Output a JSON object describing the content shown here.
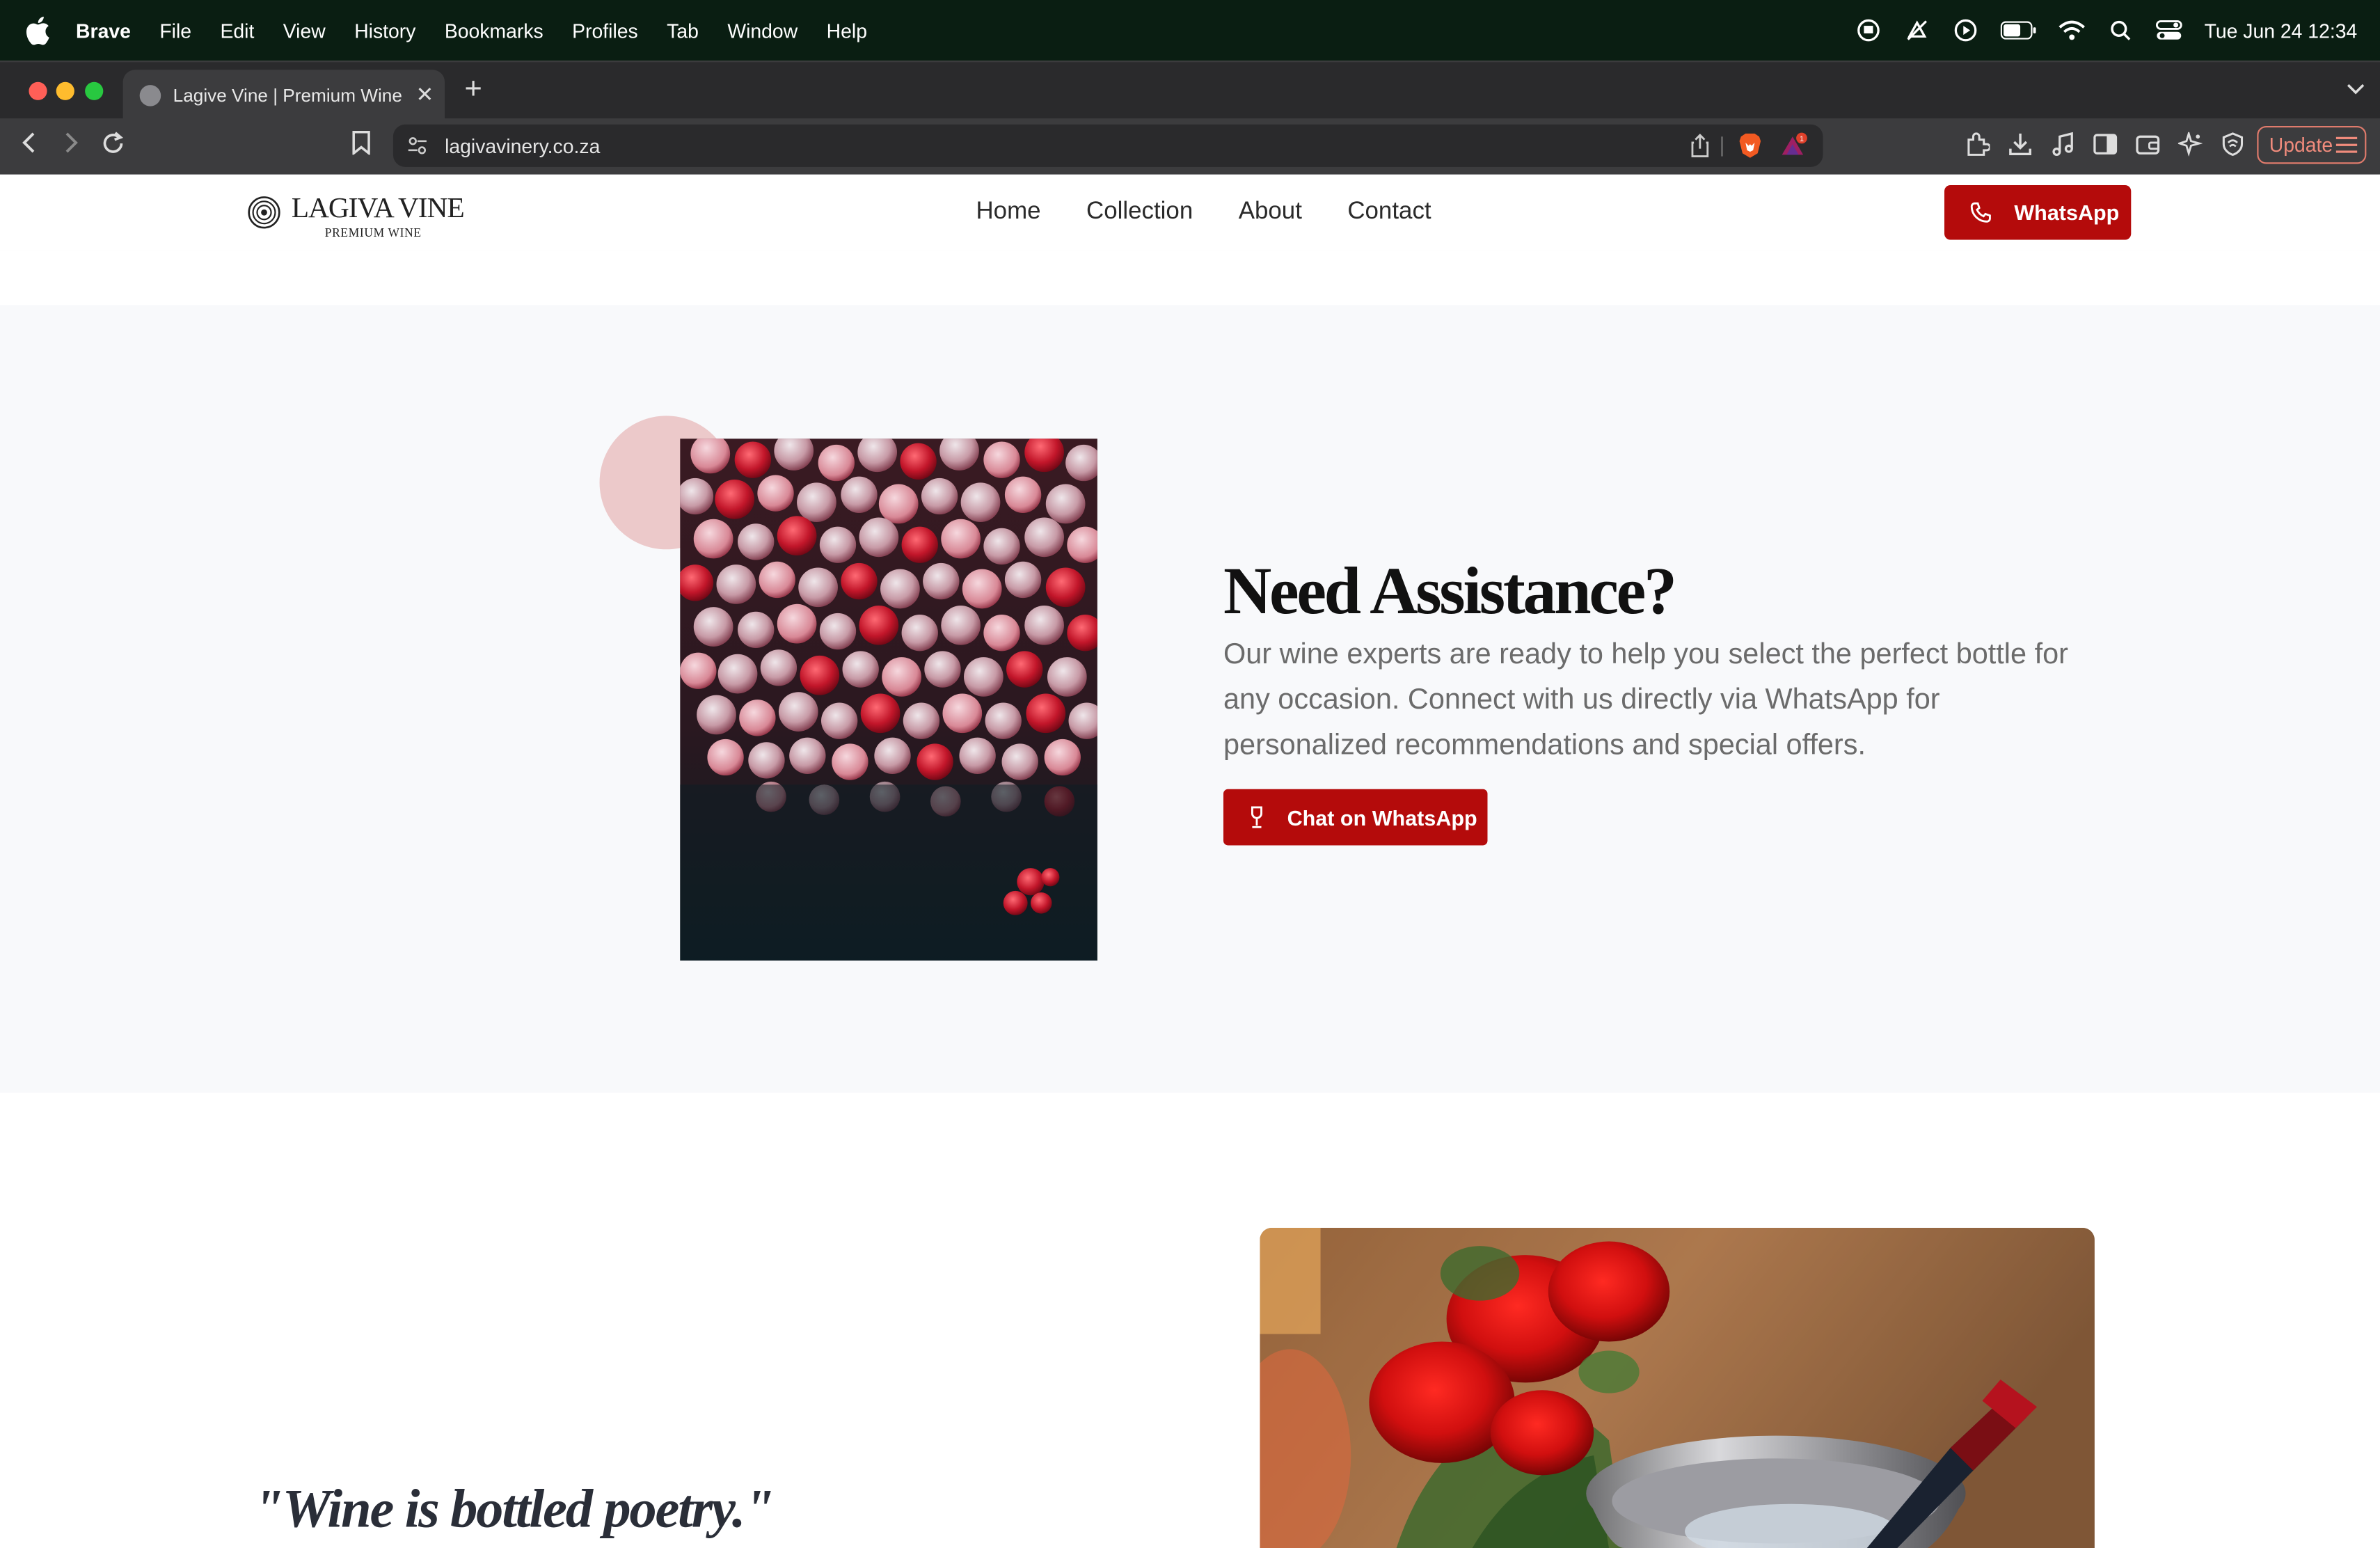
{
  "menubar": {
    "app_name": "Brave",
    "menus": [
      "File",
      "Edit",
      "View",
      "History",
      "Bookmarks",
      "Profiles",
      "Tab",
      "Window",
      "Help"
    ],
    "clock": "Tue Jun 24  12:34",
    "status_icons": [
      "screen-sharing-icon",
      "focus-icon",
      "play-icon",
      "battery-icon",
      "wifi-icon",
      "search-icon",
      "control-center-icon"
    ]
  },
  "browser": {
    "tab_title": "Lagive Vine | Premium Wine C",
    "url": "lagivavinery.co.za",
    "update_label": "Update",
    "rewards_badge": "1"
  },
  "site": {
    "logo_name": "LAGIVA VINE",
    "logo_sub": "PREMIUM WINE",
    "nav": [
      "Home",
      "Collection",
      "About",
      "Contact"
    ],
    "whatsapp_label": "WhatsApp"
  },
  "assist": {
    "heading": "Need Assistance?",
    "body": "Our wine experts are ready to help you select the perfect bottle for any occasion. Connect with us directly via WhatsApp for personalized recommendations and special offers.",
    "button_label": "Chat on WhatsApp"
  },
  "quote": {
    "text": "\"Wine is bottled poetry.\""
  },
  "colors": {
    "brand_red": "#b40b0b",
    "accent_pink": "#ecc9ca",
    "section_bg": "#f8f9fb",
    "menubar_bg": "#0a1e12"
  }
}
